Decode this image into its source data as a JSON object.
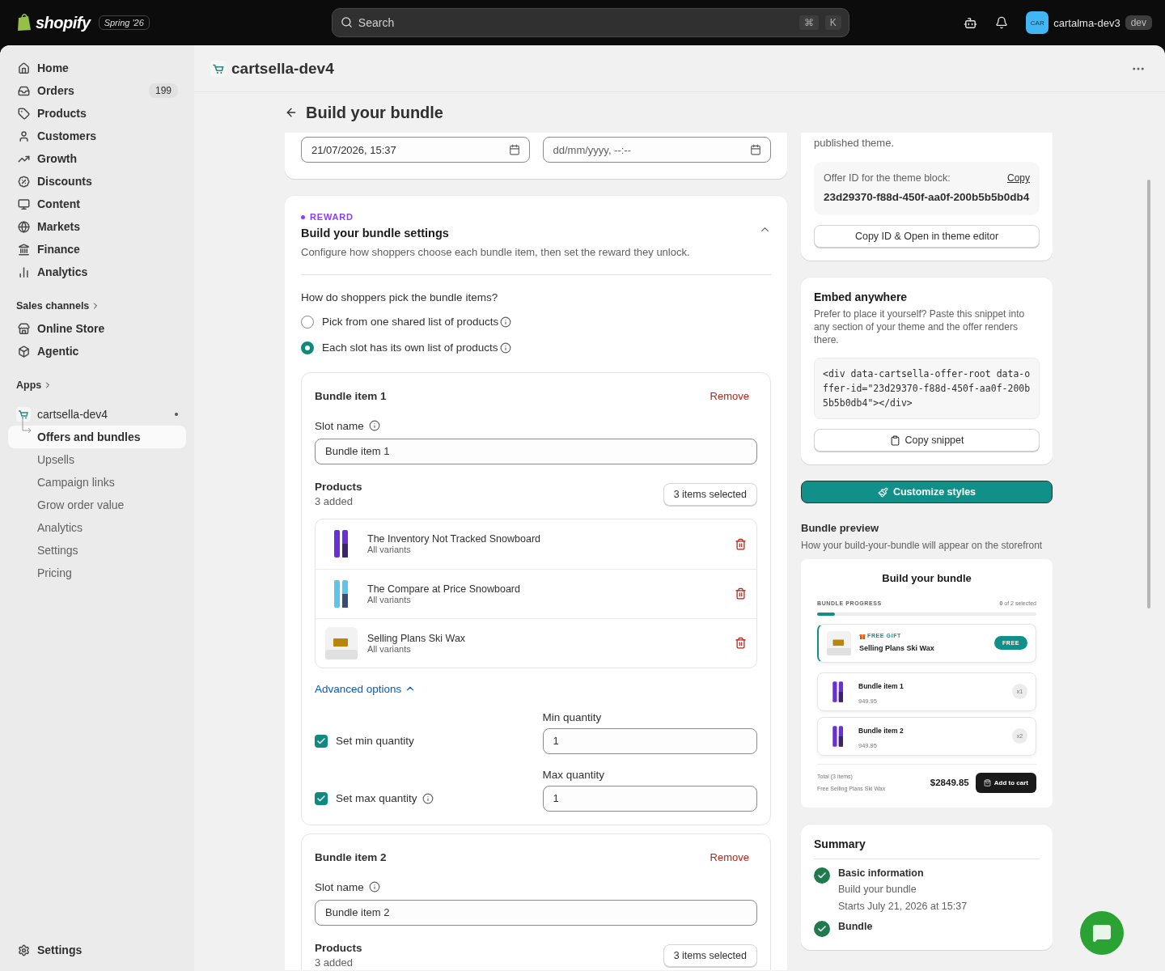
{
  "topbar": {
    "logo": "shopify",
    "edition": "Spring '26",
    "search": {
      "placeholder": "Search",
      "keys": [
        "⌘",
        "K"
      ]
    },
    "avatar": "CAR",
    "store": "cartalma-dev3",
    "badge": "dev"
  },
  "sidebar": {
    "items": [
      {
        "label": "Home",
        "selected": false
      },
      {
        "label": "Orders",
        "badge": "199",
        "selected": false
      },
      {
        "label": "Products",
        "selected": false
      },
      {
        "label": "Customers",
        "selected": false
      },
      {
        "label": "Growth",
        "selected": false
      },
      {
        "label": "Discounts",
        "selected": false
      },
      {
        "label": "Content",
        "selected": false
      },
      {
        "label": "Markets",
        "selected": false
      },
      {
        "label": "Finance",
        "selected": false
      },
      {
        "label": "Analytics",
        "selected": false
      }
    ],
    "sales_channels": {
      "label": "Sales channels",
      "items": [
        {
          "label": "Online Store",
          "selected": false
        },
        {
          "label": "Agentic",
          "selected": false
        }
      ]
    },
    "apps": {
      "label": "Apps"
    },
    "app": {
      "name": "cartsella-dev4",
      "items": [
        {
          "label": "Offers and bundles",
          "selected": true
        },
        {
          "label": "Upsells",
          "selected": false
        },
        {
          "label": "Campaign links",
          "selected": false
        },
        {
          "label": "Grow order value",
          "selected": false
        },
        {
          "label": "Analytics",
          "selected": false
        },
        {
          "label": "Settings",
          "selected": false
        },
        {
          "label": "Pricing",
          "selected": false
        }
      ]
    },
    "settings": "Settings"
  },
  "app_header": {
    "title": "cartsella-dev4"
  },
  "page": {
    "title": "Build your bundle"
  },
  "schedule": {
    "start": {
      "value": "21/07/2026, 15:37"
    },
    "end": {
      "placeholder": "dd/mm/yyyy, --:--"
    }
  },
  "reward": {
    "tag": "REWARD",
    "title": "Build your bundle settings",
    "description": "Configure how shoppers choose each bundle item, then set the reward they unlock.",
    "expanded": true,
    "question": "How do shoppers pick the bundle items?",
    "options": [
      {
        "label": "Pick from one shared list of products",
        "selected": false
      },
      {
        "label": "Each slot has its own list of products",
        "selected": true
      }
    ],
    "bundle_items": [
      {
        "title": "Bundle item 1",
        "remove": "Remove",
        "slot_label": "Slot name",
        "slot_value": "Bundle item 1",
        "products_label": "Products",
        "added": "3 added",
        "select_button": "3 items selected",
        "products": [
          {
            "name": "The Inventory Not Tracked Snowboard",
            "variants": "All variants",
            "kind": "board",
            "color": "#6a2fd6"
          },
          {
            "name": "The Compare at Price Snowboard",
            "variants": "All variants",
            "kind": "board",
            "color": "#5cc6ea"
          },
          {
            "name": "Selling Plans Ski Wax",
            "variants": "All variants",
            "kind": "wax"
          }
        ],
        "advanced": {
          "label": "Advanced options",
          "expanded": true,
          "min": {
            "label": "Set min quantity",
            "checked": true,
            "field_label": "Min quantity",
            "value": "1"
          },
          "max": {
            "label": "Set max quantity",
            "checked": true,
            "field_label": "Max quantity",
            "value": "1"
          }
        }
      },
      {
        "title": "Bundle item 2",
        "remove": "Remove",
        "slot_label": "Slot name",
        "slot_value": "Bundle item 2",
        "products_label": "Products",
        "added": "3 added",
        "select_button": "3 items selected"
      }
    ]
  },
  "theme_card": {
    "note": "published theme.",
    "offer_label": "Offer ID for the theme block:",
    "copy": "Copy",
    "offer_id": "23d29370-f88d-450f-aa0f-200b5b5b0db4",
    "button": "Copy ID & Open in theme editor"
  },
  "embed": {
    "title": "Embed anywhere",
    "description": "Prefer to place it yourself? Paste this snippet into any section of your theme and the offer renders there.",
    "code": "<div data-cartsella-offer-root data-offer-id=\"23d29370-f88d-450f-aa0f-200b5b5b0db4\"></div>",
    "button": "Copy snippet"
  },
  "customize_button": "Customize styles",
  "preview": {
    "title": "Bundle preview",
    "description": "How your build-your-bundle will appear on the storefront",
    "heading": "Build your bundle",
    "progress_label": "BUNDLE PROGRESS",
    "progress_count": "**0** of 2 selected",
    "level": 0.08,
    "gift": {
      "tag": "FREE GIFT",
      "name": "Selling Plans Ski Wax",
      "badge": "FREE",
      "kind": "wax"
    },
    "items": [
      {
        "name": "Bundle item 1",
        "price": "949.95",
        "qty": "x1",
        "kind": "board",
        "color": "#6a2fd6"
      },
      {
        "name": "Bundle item 2",
        "price": "949.95",
        "qty": "x2",
        "kind": "board",
        "color": "#6a2fd6"
      }
    ],
    "total_label": "Total (3 items)",
    "total_note": "Free Selling Plans Ski Wax",
    "total": "$2849.85",
    "cart_button": "Add to cart"
  },
  "summary": {
    "title": "Summary",
    "steps": [
      {
        "title": "Basic information",
        "lines": [
          "Build your bundle",
          "Starts July 21, 2026 at 15:37"
        ],
        "done": true
      },
      {
        "title": "Bundle",
        "done": true
      }
    ]
  }
}
